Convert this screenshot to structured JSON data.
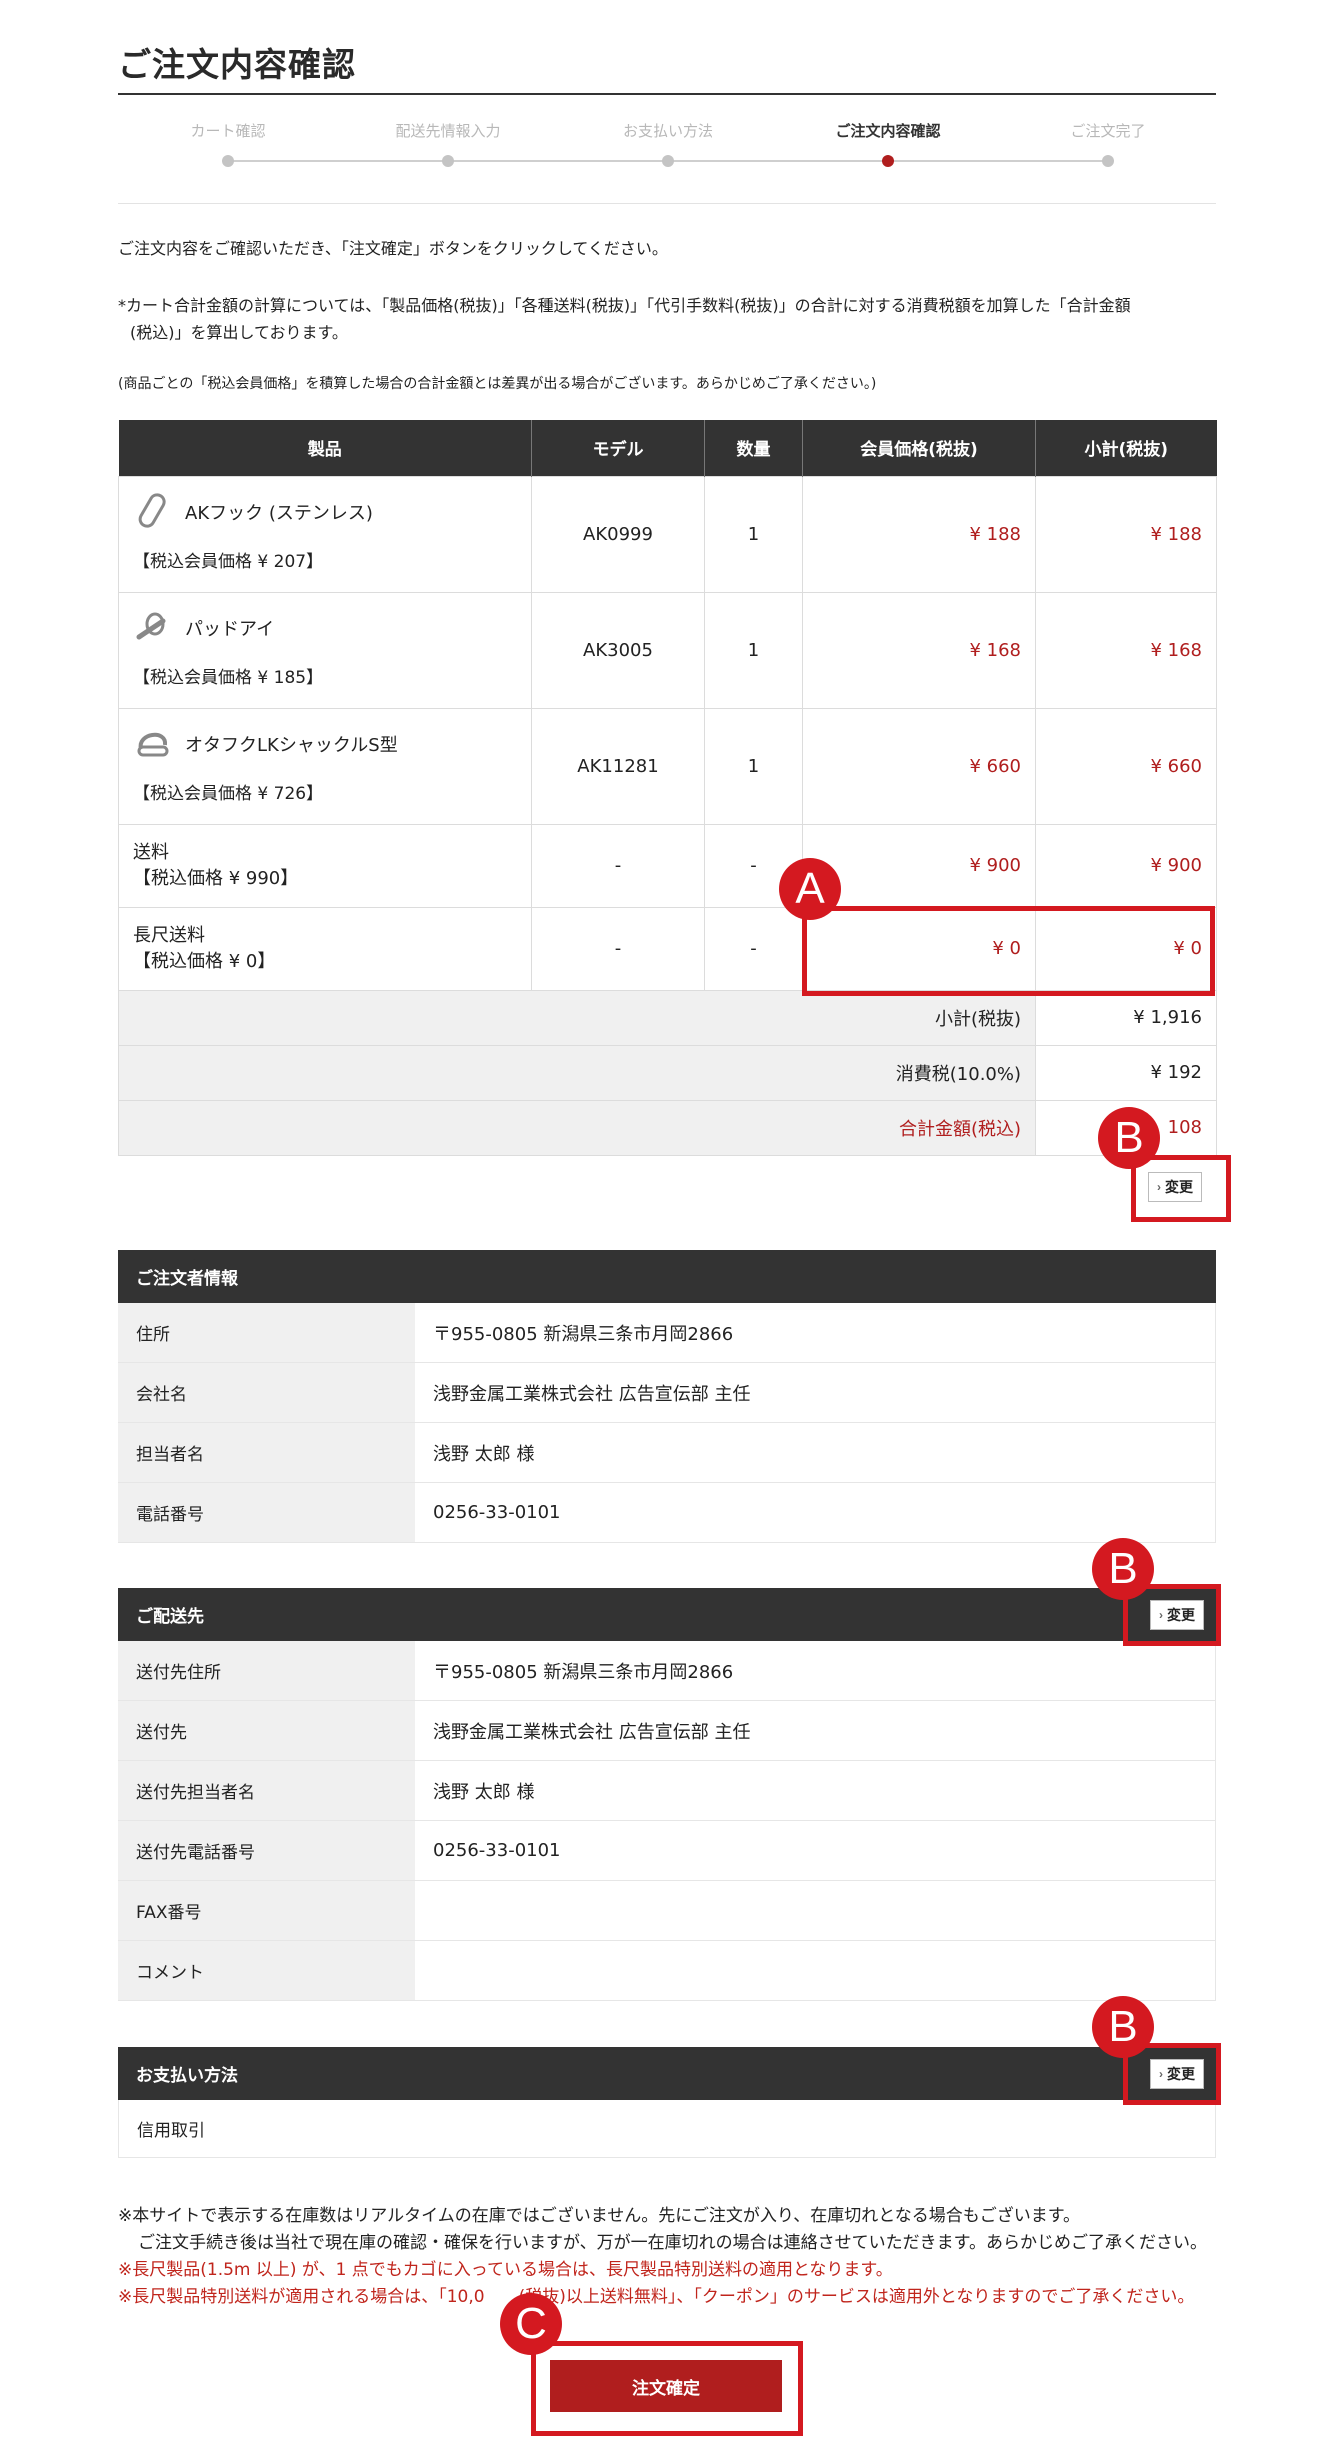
{
  "page": {
    "title": "ご注文内容確認"
  },
  "steps": [
    {
      "label": "カート確認",
      "active": false
    },
    {
      "label": "配送先情報入力",
      "active": false
    },
    {
      "label": "お支払い方法",
      "active": false
    },
    {
      "label": "ご注文内容確認",
      "active": true
    },
    {
      "label": "ご注文完了",
      "active": false
    }
  ],
  "intro": {
    "line1": "ご注文内容をご確認いただき、「注文確定」ボタンをクリックしてください。",
    "line2a": "*カート合計金額の計算については、「製品価格(税抜)」「各種送料(税抜)」「代引手数料(税抜)」の合計に対する消費税額を加算した「合計金額",
    "line2b": "(税込)」を算出しております。",
    "line3": "(商品ごとの「税込会員価格」を積算した場合の合計金額とは差異が出る場合がございます。あらかじめご了承ください。)"
  },
  "cart": {
    "headers": [
      "製品",
      "モデル",
      "数量",
      "会員価格(税抜)",
      "小計(税抜)"
    ],
    "items": [
      {
        "icon": "carabiner-hook-icon",
        "name": "AKフック (ステンレス)",
        "tax_price": "【税込会員価格 ¥ 207】",
        "model": "AK0999",
        "qty": "1",
        "price": "¥ 188",
        "subtotal": "¥ 188"
      },
      {
        "icon": "pad-eye-icon",
        "name": "パッドアイ",
        "tax_price": "【税込会員価格 ¥ 185】",
        "model": "AK3005",
        "qty": "1",
        "price": "¥ 168",
        "subtotal": "¥ 168"
      },
      {
        "icon": "shackle-icon",
        "name": "オタフクLKシャックルS型",
        "tax_price": "【税込会員価格 ¥ 726】",
        "model": "AK11281",
        "qty": "1",
        "price": "¥ 660",
        "subtotal": "¥ 660"
      }
    ],
    "fees": [
      {
        "name": "送料",
        "tax_price": "【税込価格 ¥ 990】",
        "model": "-",
        "qty": "-",
        "price": "¥ 900",
        "subtotal": "¥ 900"
      },
      {
        "name": "長尺送料",
        "tax_price": "【税込価格 ¥ 0】",
        "model": "-",
        "qty": "-",
        "price": "¥ 0",
        "subtotal": "¥ 0"
      }
    ],
    "summary": [
      {
        "label": "小計(税抜)",
        "value": "¥ 1,916"
      },
      {
        "label": "消費税(10.0%)",
        "value": "¥ 192"
      },
      {
        "label": "合計金額(税込)",
        "value": "108"
      }
    ],
    "change_label": "変更"
  },
  "orderer": {
    "title": "ご注文者情報",
    "rows": [
      {
        "k": "住所",
        "v": "〒955-0805 新潟県三条市月岡2866"
      },
      {
        "k": "会社名",
        "v": "浅野金属工業株式会社 広告宣伝部 主任"
      },
      {
        "k": "担当者名",
        "v": "浅野 太郎 様"
      },
      {
        "k": "電話番号",
        "v": "0256-33-0101"
      }
    ]
  },
  "delivery": {
    "title": "ご配送先",
    "change_label": "変更",
    "rows": [
      {
        "k": "送付先住所",
        "v": "〒955-0805 新潟県三条市月岡2866"
      },
      {
        "k": "送付先",
        "v": "浅野金属工業株式会社 広告宣伝部 主任"
      },
      {
        "k": "送付先担当者名",
        "v": "浅野 太郎 様"
      },
      {
        "k": "送付先電話番号",
        "v": "0256-33-0101"
      },
      {
        "k": "FAX番号",
        "v": ""
      },
      {
        "k": "コメント",
        "v": ""
      }
    ]
  },
  "payment": {
    "title": "お支払い方法",
    "change_label": "変更",
    "value": "信用取引"
  },
  "notes": {
    "n1": "※本サイトで表示する在庫数はリアルタイムの在庫ではございません。先にご注文が入り、在庫切れとなる場合もございます。",
    "n2": "ご注文手続き後は当社で現在庫の確認・確保を行いますが、万が一在庫切れの場合は連絡させていただきます。あらかじめご了承ください。",
    "n3": "※長尺製品(1.5m 以上) が、1 点でもカゴに入っている場合は、長尺製品特別送料の適用となります。",
    "n4": "※長尺製品特別送料が適用される場合は、「10,0　　(税抜)以上送料無料」、「クーポン」のサービスは適用外となりますのでご了承ください。"
  },
  "confirm_label": "注文確定",
  "annotations": {
    "a": "A",
    "b": "B",
    "c": "C"
  },
  "colors": {
    "accent": "#b01e1e",
    "annotation": "#d41920",
    "header": "#333333"
  }
}
